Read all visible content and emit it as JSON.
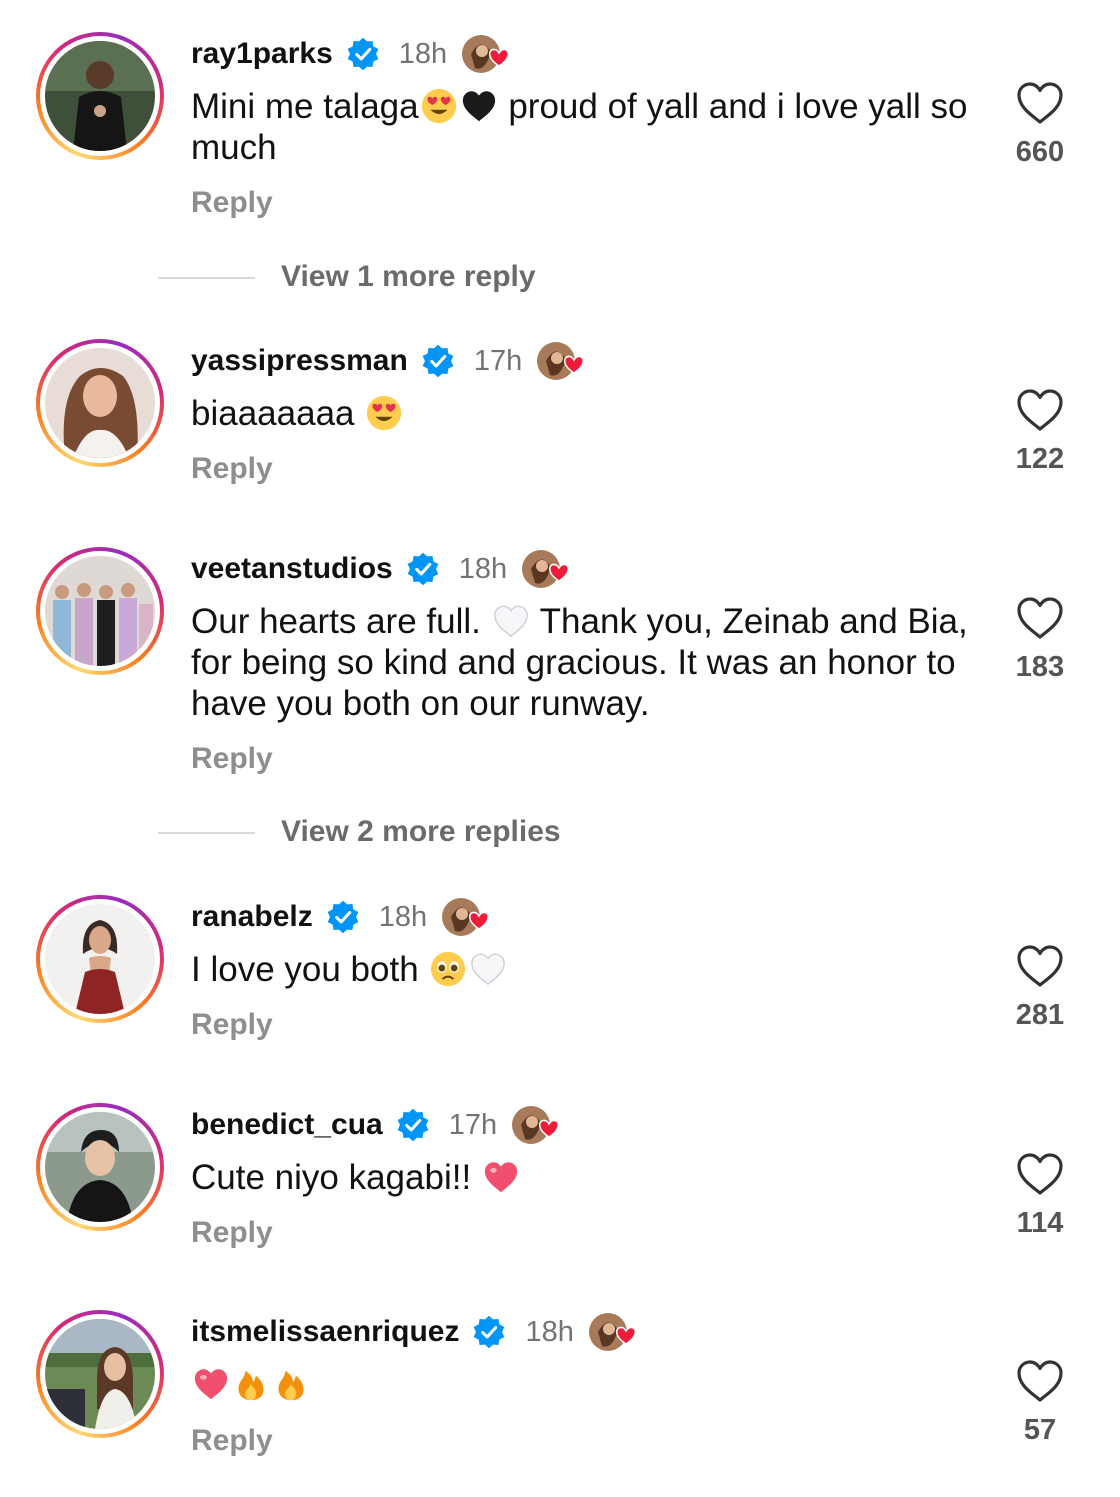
{
  "comments": [
    {
      "username": "ray1parks",
      "time": "18h",
      "text_parts": [
        "Mini me talaga",
        "",
        " proud of yall and i love yall so much"
      ],
      "emojis": [
        "heart-eyes",
        "black-heart"
      ],
      "reply_label": "Reply",
      "likes": "660",
      "avatar": "man-in-dark-suit"
    },
    {
      "username": "yassipressman",
      "time": "17h",
      "text_parts": [
        "biaaaaaaa "
      ],
      "emojis": [
        "heart-eyes"
      ],
      "reply_label": "Reply",
      "likes": "122",
      "avatar": "woman-long-hair"
    },
    {
      "username": "veetanstudios",
      "time": "18h",
      "text_parts": [
        "Our hearts are full. ",
        " Thank you, Zeinab and Bia, for being so kind and gracious. It was an honor to have you both on our runway."
      ],
      "emojis": [
        "white-heart"
      ],
      "reply_label": "Reply",
      "likes": "183",
      "avatar": "group-photo"
    },
    {
      "username": "ranabelz",
      "time": "18h",
      "text_parts": [
        "I love you both "
      ],
      "emojis": [
        "pleading-face",
        "white-heart"
      ],
      "reply_label": "Reply",
      "likes": "281",
      "avatar": "woman-red-dress"
    },
    {
      "username": "benedict_cua",
      "time": "17h",
      "text_parts": [
        "Cute niyo kagabi!! "
      ],
      "emojis": [
        "red-heart"
      ],
      "reply_label": "Reply",
      "likes": "114",
      "avatar": "man-black-shirt"
    },
    {
      "username": "itsmelissaenriquez",
      "time": "18h",
      "text_parts": [
        ""
      ],
      "emojis": [
        "pink-heart",
        "fire",
        "fire"
      ],
      "reply_label": "Reply",
      "likes": "57",
      "avatar": "woman-stadium"
    }
  ],
  "view_replies": [
    {
      "label": "View 1 more reply"
    },
    {
      "label": "View 2 more replies"
    }
  ],
  "colors": {
    "verified": "#0095f6",
    "like_badge_heart": "#ed1c3a",
    "muted_text": "#737373",
    "reply_text": "#8e8e8e"
  }
}
